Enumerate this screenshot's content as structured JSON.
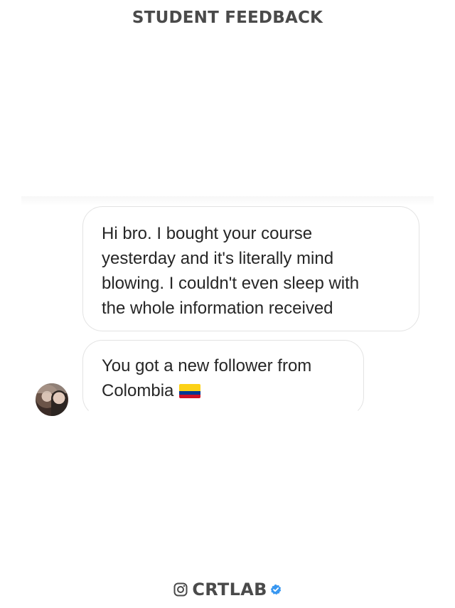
{
  "header": {
    "title": "STUDENT FEEDBACK"
  },
  "messages": [
    {
      "lines": [
        "Hi bro. I bought your course",
        "yesterday and it's literally mind",
        "blowing. I couldn't even sleep with",
        "the whole information received"
      ]
    },
    {
      "lines": [
        "You got a new follower from",
        "Colombia"
      ],
      "emoji": "colombia-flag-icon"
    }
  ],
  "footer": {
    "icon": "instagram-icon",
    "brand": "CRTLAB",
    "badge_icon": "verified-badge-icon",
    "badge_color": "#3897f0"
  },
  "colors": {
    "title": "#4a4a4a",
    "bubble_border": "#e3e3e3",
    "message_text": "#262626"
  }
}
